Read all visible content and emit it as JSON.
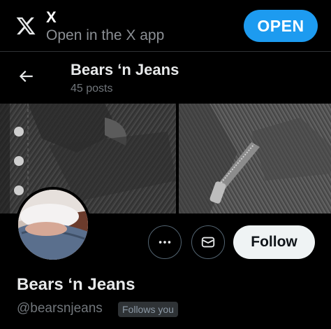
{
  "app_banner": {
    "app_name": "X",
    "subtitle": "Open in the X app",
    "open_label": "OPEN",
    "logo_icon": "x-logo-icon"
  },
  "header": {
    "back_icon": "arrow-left-icon",
    "title": "Bears ‘n Jeans",
    "post_count": "45 posts"
  },
  "profile": {
    "display_name": "Bears ‘n Jeans",
    "handle": "@bearsnjeans",
    "follows_you_badge": "Follows you",
    "actions": {
      "more_icon": "more-horizontal-icon",
      "message_icon": "envelope-icon",
      "follow_label": "Follow"
    }
  },
  "colors": {
    "accent": "#1d9bf0",
    "background": "#000000",
    "follow_button_bg": "#eff3f4",
    "muted_text": "#71767b"
  }
}
